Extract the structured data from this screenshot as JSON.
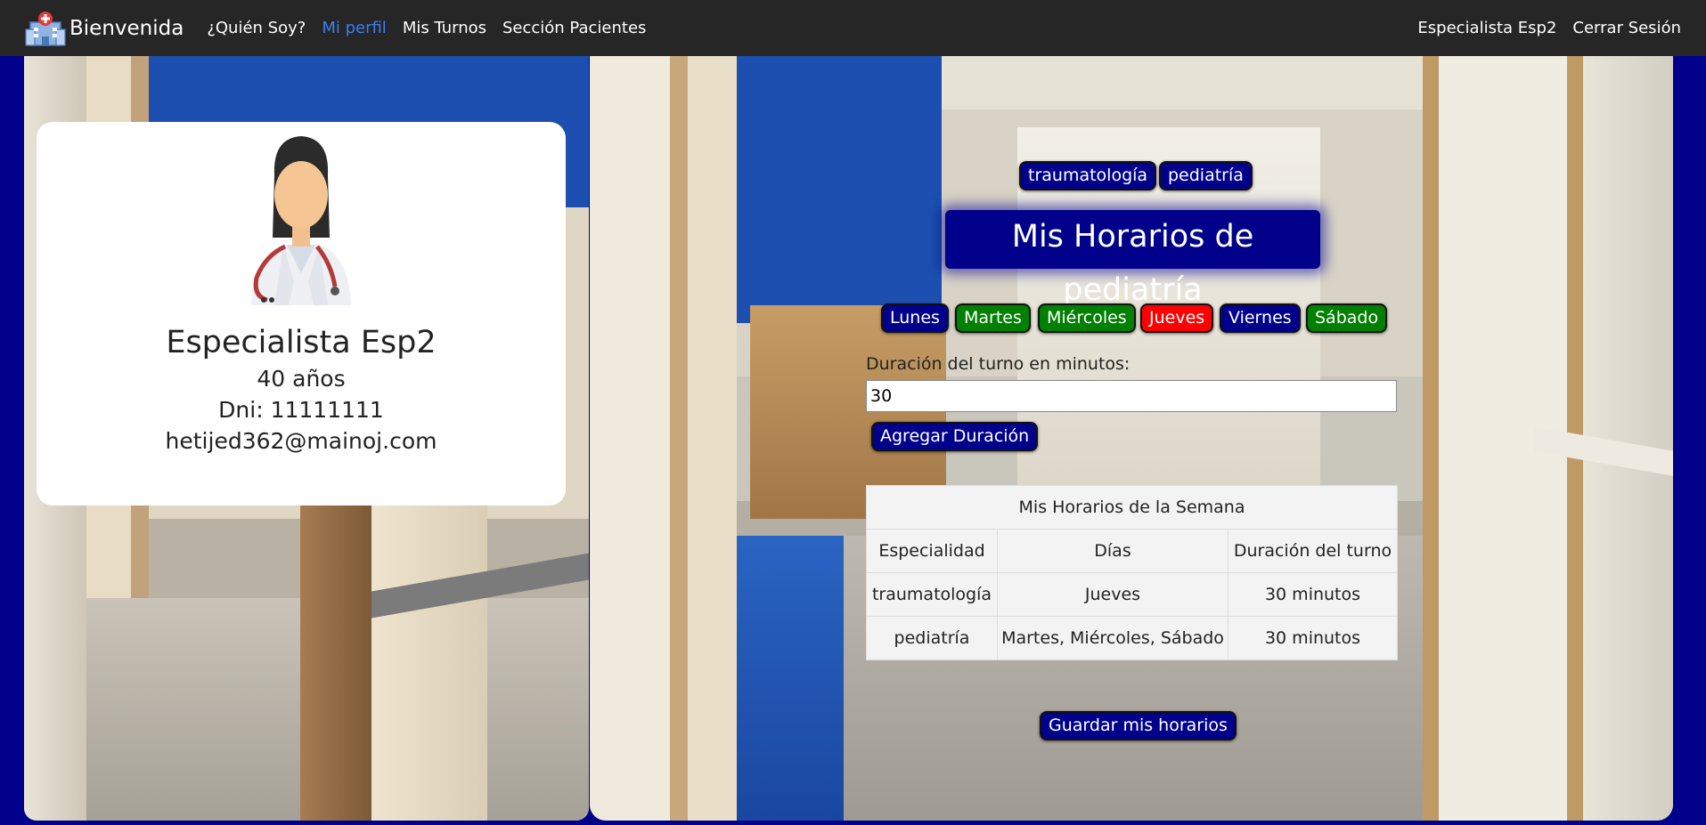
{
  "navbar": {
    "brand": "Bienvenida",
    "links": [
      "¿Quién Soy?",
      "Mi perfil",
      "Mis Turnos",
      "Sección Pacientes"
    ],
    "user": "Especialista Esp2",
    "logout": "Cerrar Sesión",
    "active_color": "#3d7ef5"
  },
  "profile": {
    "name": "Especialista Esp2",
    "age": "40 años",
    "dni": "Dni: 11111111",
    "email": "hetijed362@mainoj.com"
  },
  "specialties": [
    "traumatología",
    "pediatría"
  ],
  "schedule_title": "Mis Horarios de pediatría",
  "days": [
    {
      "label": "Lunes",
      "state": "navy"
    },
    {
      "label": "Martes",
      "state": "green"
    },
    {
      "label": "Miércoles",
      "state": "green"
    },
    {
      "label": "Jueves",
      "state": "red"
    },
    {
      "label": "Viernes",
      "state": "navy"
    },
    {
      "label": "Sábado",
      "state": "green"
    }
  ],
  "colors": {
    "navy": "#00008b",
    "green": "#008000",
    "red": "#ff0000"
  },
  "duration": {
    "label": "Duración del turno en minutos:",
    "value": "30",
    "add_button": "Agregar Duración"
  },
  "table": {
    "caption": "Mis Horarios de la Semana",
    "headers": [
      "Especialidad",
      "Días",
      "Duración del turno"
    ],
    "rows": [
      [
        "traumatología",
        "Jueves",
        "30 minutos"
      ],
      [
        "pediatría",
        "Martes, Miércoles, Sábado",
        "30 minutos"
      ]
    ]
  },
  "save_button": "Guardar mis horarios"
}
